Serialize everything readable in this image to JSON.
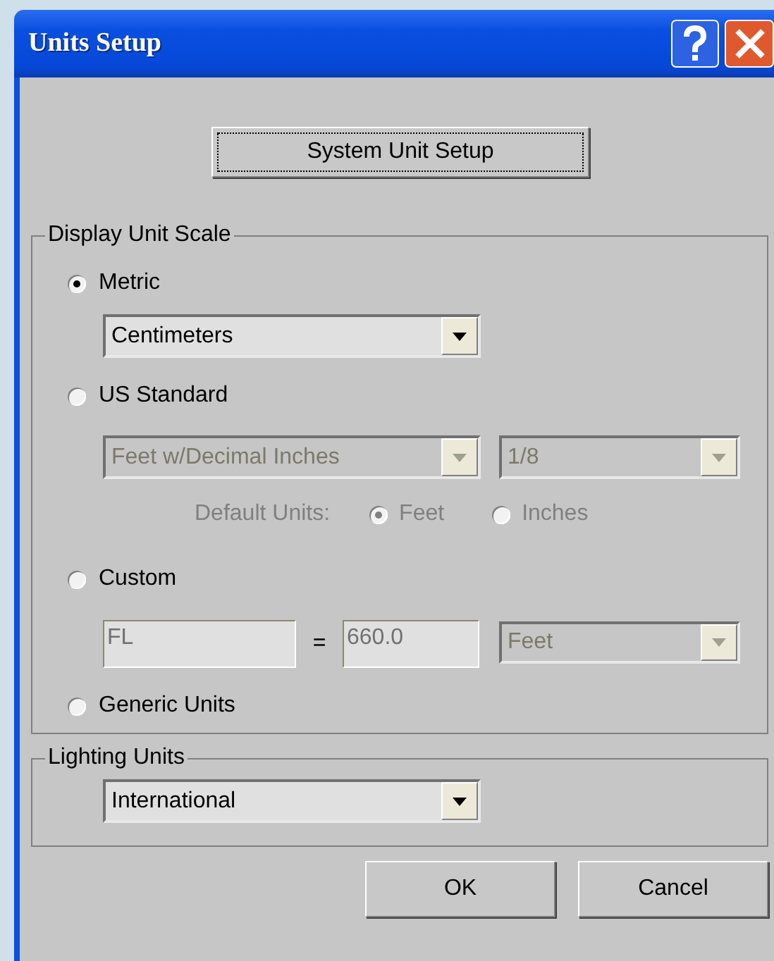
{
  "window": {
    "title": "Units Setup"
  },
  "system_button": {
    "label": "System Unit Setup",
    "focused": true
  },
  "display_unit_scale": {
    "title": "Display Unit Scale",
    "metric": {
      "label": "Metric",
      "selected": true,
      "dropdown": {
        "value": "Centimeters",
        "disabled": false
      }
    },
    "us_standard": {
      "label": "US Standard",
      "selected": false,
      "dropdowns": [
        {
          "value": "Feet w/Decimal Inches",
          "disabled": true
        },
        {
          "value": "1/8",
          "disabled": true
        }
      ],
      "default_units": {
        "label": "Default Units:",
        "disabled": true,
        "options": [
          {
            "label": "Feet",
            "selected": true
          },
          {
            "label": "Inches",
            "selected": false
          }
        ]
      }
    },
    "custom": {
      "label": "Custom",
      "selected": false,
      "name_field": {
        "value": "FL",
        "disabled": true
      },
      "equals": "=",
      "value_field": {
        "value": "660.0",
        "disabled": true
      },
      "dropdown": {
        "value": "Feet",
        "disabled": true
      }
    },
    "generic": {
      "label": "Generic Units",
      "selected": false
    }
  },
  "lighting_units": {
    "title": "Lighting Units",
    "dropdown": {
      "value": "International",
      "disabled": false
    }
  },
  "buttons": [
    {
      "label": "OK"
    },
    {
      "label": "Cancel"
    }
  ]
}
